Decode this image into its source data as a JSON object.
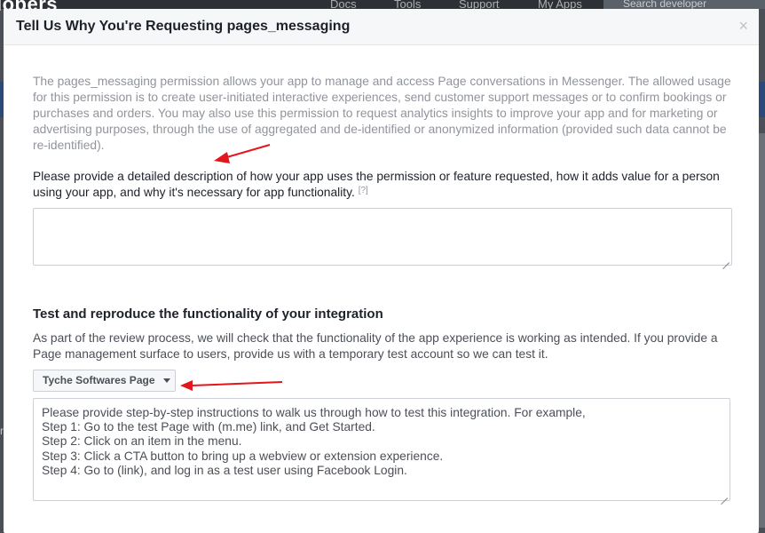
{
  "background": {
    "brand": "lopers",
    "nav_items": [
      "Docs",
      "Tools",
      "Support",
      "My Apps"
    ],
    "search_placeholder": "Search developer documentation"
  },
  "modal": {
    "title": "Tell Us Why You're Requesting pages_messaging",
    "close_symbol": "×",
    "intro": "The pages_messaging permission allows your app to manage and access Page conversations in Messenger. The allowed usage for this permission is to create user-initiated interactive experiences, send customer support messages or to confirm bookings or purchases and orders. You may also use this permission to request analytics insights to improve your app and for marketing or advertising purposes, through the use of aggregated and de-identified or anonymized information (provided such data cannot be re-identified).",
    "description_prompt": "Please provide a detailed description of how your app uses the permission or feature requested, how it adds value for a person using your app, and why it's necessary for app functionality.",
    "help_marker": "[?]",
    "description_value": ""
  },
  "test_section": {
    "heading": "Test and reproduce the functionality of your integration",
    "description": "As part of the review process, we will check that the functionality of the app experience is working as intended. If you provide a Page management surface to users, provide us with a temporary test account so we can test it.",
    "page_selector": "Tyche Softwares Page",
    "instructions_placeholder": [
      "Please provide step-by-step instructions to walk us through how to test this integration. For example,",
      "Step 1: Go to the test Page with (m.me) link, and Get Started.",
      "Step 2: Click on an item in the menu.",
      "Step 3: Click a CTA button to bring up a webview or extension experience.",
      "Step 4: Go to (link), and log in as a test user using Facebook Login."
    ]
  },
  "colors": {
    "annotation_arrow": "#e3161d",
    "modal_header_bg": "#f6f7f9",
    "overlay": "#4b4f56"
  }
}
